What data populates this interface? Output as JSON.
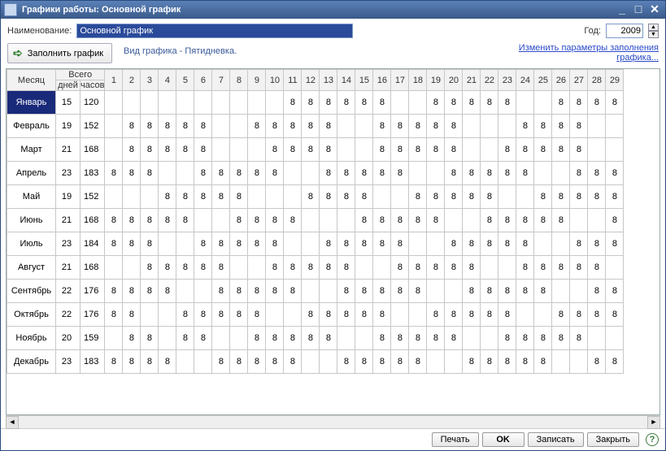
{
  "window": {
    "title": "Графики работы: Основной график"
  },
  "labels": {
    "name": "Наименование:",
    "year": "Год:",
    "info": "Вид графика - Пятидневка.",
    "fill": "Заполнить график",
    "change_link": "Изменить параметры заполнения графика...",
    "month": "Месяц",
    "total": "Всего",
    "days": "дней",
    "hours": "часов",
    "print": "Печать",
    "ok": "OK",
    "save": "Записать",
    "close": "Закрыть"
  },
  "fields": {
    "name_value": "Основной график",
    "year_value": "2009"
  },
  "days_header": [
    "1",
    "2",
    "3",
    "4",
    "5",
    "6",
    "7",
    "8",
    "9",
    "10",
    "11",
    "12",
    "13",
    "14",
    "15",
    "16",
    "17",
    "18",
    "19",
    "20",
    "21",
    "22",
    "23",
    "24",
    "25",
    "26",
    "27",
    "28",
    "29"
  ],
  "months": [
    {
      "name": "Январь",
      "days": "15",
      "hours": "120",
      "cells": [
        {
          "v": "",
          "w": true
        },
        {
          "v": "",
          "w": true
        },
        {
          "v": "",
          "w": true
        },
        {
          "v": "",
          "w": true
        },
        {
          "v": "",
          "w": true
        },
        {
          "v": "",
          "w": true
        },
        {
          "v": "",
          "w": true
        },
        {
          "v": "",
          "w": true
        },
        {
          "v": "",
          "w": true
        },
        {
          "v": "",
          "w": true
        },
        {
          "v": "8"
        },
        {
          "v": "8"
        },
        {
          "v": "8"
        },
        {
          "v": "8"
        },
        {
          "v": "8"
        },
        {
          "v": "8"
        },
        {
          "v": "",
          "w": true
        },
        {
          "v": "",
          "w": true
        },
        {
          "v": "8"
        },
        {
          "v": "8"
        },
        {
          "v": "8"
        },
        {
          "v": "8"
        },
        {
          "v": "8"
        },
        {
          "v": "",
          "w": true
        },
        {
          "v": "",
          "w": true
        },
        {
          "v": "8"
        },
        {
          "v": "8"
        },
        {
          "v": "8"
        },
        {
          "v": "8"
        }
      ]
    },
    {
      "name": "Февраль",
      "days": "19",
      "hours": "152",
      "cells": [
        {
          "v": "",
          "w": true
        },
        {
          "v": "8"
        },
        {
          "v": "8"
        },
        {
          "v": "8"
        },
        {
          "v": "8"
        },
        {
          "v": "8"
        },
        {
          "v": "",
          "w": true
        },
        {
          "v": "",
          "w": true
        },
        {
          "v": "8"
        },
        {
          "v": "8"
        },
        {
          "v": "8"
        },
        {
          "v": "8"
        },
        {
          "v": "8"
        },
        {
          "v": "",
          "w": true
        },
        {
          "v": "",
          "w": true
        },
        {
          "v": "8"
        },
        {
          "v": "8"
        },
        {
          "v": "8"
        },
        {
          "v": "8"
        },
        {
          "v": "8"
        },
        {
          "v": "",
          "w": true
        },
        {
          "v": "",
          "w": true
        },
        {
          "v": "",
          "w": true
        },
        {
          "v": "8"
        },
        {
          "v": "8"
        },
        {
          "v": "8"
        },
        {
          "v": "8"
        },
        {
          "v": "",
          "w": true
        },
        {
          "v": ""
        }
      ]
    },
    {
      "name": "Март",
      "days": "21",
      "hours": "168",
      "cells": [
        {
          "v": "",
          "w": true
        },
        {
          "v": "8"
        },
        {
          "v": "8"
        },
        {
          "v": "8"
        },
        {
          "v": "8"
        },
        {
          "v": "8"
        },
        {
          "v": "",
          "w": true
        },
        {
          "v": "",
          "w": true
        },
        {
          "v": "",
          "w": true
        },
        {
          "v": "8"
        },
        {
          "v": "8"
        },
        {
          "v": "8"
        },
        {
          "v": "8"
        },
        {
          "v": "",
          "w": true
        },
        {
          "v": "",
          "w": true
        },
        {
          "v": "8"
        },
        {
          "v": "8"
        },
        {
          "v": "8"
        },
        {
          "v": "8"
        },
        {
          "v": "8"
        },
        {
          "v": "",
          "w": true
        },
        {
          "v": "",
          "w": true
        },
        {
          "v": "8"
        },
        {
          "v": "8"
        },
        {
          "v": "8"
        },
        {
          "v": "8"
        },
        {
          "v": "8"
        },
        {
          "v": "",
          "w": true
        },
        {
          "v": "",
          "w": true
        }
      ]
    },
    {
      "name": "Апрель",
      "days": "23",
      "hours": "183",
      "cells": [
        {
          "v": "8"
        },
        {
          "v": "8"
        },
        {
          "v": "8"
        },
        {
          "v": "",
          "w": true
        },
        {
          "v": "",
          "w": true
        },
        {
          "v": "8"
        },
        {
          "v": "8"
        },
        {
          "v": "8"
        },
        {
          "v": "8"
        },
        {
          "v": "8"
        },
        {
          "v": "",
          "w": true
        },
        {
          "v": "",
          "w": true
        },
        {
          "v": "8"
        },
        {
          "v": "8"
        },
        {
          "v": "8"
        },
        {
          "v": "8"
        },
        {
          "v": "8"
        },
        {
          "v": "",
          "w": true
        },
        {
          "v": "",
          "w": true
        },
        {
          "v": "8"
        },
        {
          "v": "8"
        },
        {
          "v": "8"
        },
        {
          "v": "8"
        },
        {
          "v": "8"
        },
        {
          "v": "",
          "w": true
        },
        {
          "v": "",
          "w": true
        },
        {
          "v": "8"
        },
        {
          "v": "8"
        },
        {
          "v": "8"
        }
      ]
    },
    {
      "name": "Май",
      "days": "19",
      "hours": "152",
      "cells": [
        {
          "v": "",
          "w": true
        },
        {
          "v": "",
          "w": true
        },
        {
          "v": "",
          "w": true
        },
        {
          "v": "8"
        },
        {
          "v": "8"
        },
        {
          "v": "8"
        },
        {
          "v": "8"
        },
        {
          "v": "8"
        },
        {
          "v": "",
          "w": true
        },
        {
          "v": "",
          "w": true
        },
        {
          "v": "",
          "w": true
        },
        {
          "v": "8"
        },
        {
          "v": "8"
        },
        {
          "v": "8"
        },
        {
          "v": "8"
        },
        {
          "v": "",
          "w": true
        },
        {
          "v": "",
          "w": true
        },
        {
          "v": "8"
        },
        {
          "v": "8"
        },
        {
          "v": "8"
        },
        {
          "v": "8"
        },
        {
          "v": "8"
        },
        {
          "v": "",
          "w": true
        },
        {
          "v": "",
          "w": true
        },
        {
          "v": "8"
        },
        {
          "v": "8"
        },
        {
          "v": "8"
        },
        {
          "v": "8"
        },
        {
          "v": "8"
        }
      ]
    },
    {
      "name": "Июнь",
      "days": "21",
      "hours": "168",
      "cells": [
        {
          "v": "8"
        },
        {
          "v": "8"
        },
        {
          "v": "8"
        },
        {
          "v": "8"
        },
        {
          "v": "8"
        },
        {
          "v": "",
          "w": true
        },
        {
          "v": "",
          "w": true
        },
        {
          "v": "8"
        },
        {
          "v": "8"
        },
        {
          "v": "8"
        },
        {
          "v": "8"
        },
        {
          "v": "",
          "w": true
        },
        {
          "v": "",
          "w": true
        },
        {
          "v": "",
          "w": true
        },
        {
          "v": "8"
        },
        {
          "v": "8"
        },
        {
          "v": "8"
        },
        {
          "v": "8"
        },
        {
          "v": "8"
        },
        {
          "v": "",
          "w": true
        },
        {
          "v": "",
          "w": true
        },
        {
          "v": "8"
        },
        {
          "v": "8"
        },
        {
          "v": "8"
        },
        {
          "v": "8"
        },
        {
          "v": "8"
        },
        {
          "v": "",
          "w": true
        },
        {
          "v": "",
          "w": true
        },
        {
          "v": "8"
        }
      ]
    },
    {
      "name": "Июль",
      "days": "23",
      "hours": "184",
      "cells": [
        {
          "v": "8"
        },
        {
          "v": "8"
        },
        {
          "v": "8"
        },
        {
          "v": "",
          "w": true
        },
        {
          "v": "",
          "w": true
        },
        {
          "v": "8"
        },
        {
          "v": "8"
        },
        {
          "v": "8"
        },
        {
          "v": "8"
        },
        {
          "v": "8"
        },
        {
          "v": "",
          "w": true
        },
        {
          "v": "",
          "w": true
        },
        {
          "v": "8"
        },
        {
          "v": "8"
        },
        {
          "v": "8"
        },
        {
          "v": "8"
        },
        {
          "v": "8"
        },
        {
          "v": "",
          "w": true
        },
        {
          "v": "",
          "w": true
        },
        {
          "v": "8"
        },
        {
          "v": "8"
        },
        {
          "v": "8"
        },
        {
          "v": "8"
        },
        {
          "v": "8"
        },
        {
          "v": "",
          "w": true
        },
        {
          "v": "",
          "w": true
        },
        {
          "v": "8"
        },
        {
          "v": "8"
        },
        {
          "v": "8"
        }
      ]
    },
    {
      "name": "Август",
      "days": "21",
      "hours": "168",
      "cells": [
        {
          "v": "",
          "w": true
        },
        {
          "v": "",
          "w": true
        },
        {
          "v": "8"
        },
        {
          "v": "8"
        },
        {
          "v": "8"
        },
        {
          "v": "8"
        },
        {
          "v": "8"
        },
        {
          "v": "",
          "w": true
        },
        {
          "v": "",
          "w": true
        },
        {
          "v": "8"
        },
        {
          "v": "8"
        },
        {
          "v": "8"
        },
        {
          "v": "8"
        },
        {
          "v": "8"
        },
        {
          "v": "",
          "w": true
        },
        {
          "v": "",
          "w": true
        },
        {
          "v": "8"
        },
        {
          "v": "8"
        },
        {
          "v": "8"
        },
        {
          "v": "8"
        },
        {
          "v": "8"
        },
        {
          "v": "",
          "w": true
        },
        {
          "v": "",
          "w": true
        },
        {
          "v": "8"
        },
        {
          "v": "8"
        },
        {
          "v": "8"
        },
        {
          "v": "8"
        },
        {
          "v": "8"
        },
        {
          "v": "",
          "w": true
        }
      ]
    },
    {
      "name": "Сентябрь",
      "days": "22",
      "hours": "176",
      "cells": [
        {
          "v": "8"
        },
        {
          "v": "8"
        },
        {
          "v": "8"
        },
        {
          "v": "8"
        },
        {
          "v": "",
          "w": true
        },
        {
          "v": "",
          "w": true
        },
        {
          "v": "8"
        },
        {
          "v": "8"
        },
        {
          "v": "8"
        },
        {
          "v": "8"
        },
        {
          "v": "8"
        },
        {
          "v": "",
          "w": true
        },
        {
          "v": "",
          "w": true
        },
        {
          "v": "8"
        },
        {
          "v": "8"
        },
        {
          "v": "8"
        },
        {
          "v": "8"
        },
        {
          "v": "8"
        },
        {
          "v": "",
          "w": true
        },
        {
          "v": "",
          "w": true
        },
        {
          "v": "8"
        },
        {
          "v": "8"
        },
        {
          "v": "8"
        },
        {
          "v": "8"
        },
        {
          "v": "8"
        },
        {
          "v": "",
          "w": true
        },
        {
          "v": "",
          "w": true
        },
        {
          "v": "8"
        },
        {
          "v": "8"
        }
      ]
    },
    {
      "name": "Октябрь",
      "days": "22",
      "hours": "176",
      "cells": [
        {
          "v": "8"
        },
        {
          "v": "8"
        },
        {
          "v": "",
          "w": true
        },
        {
          "v": "",
          "w": true
        },
        {
          "v": "8"
        },
        {
          "v": "8"
        },
        {
          "v": "8"
        },
        {
          "v": "8"
        },
        {
          "v": "8"
        },
        {
          "v": "",
          "w": true
        },
        {
          "v": "",
          "w": true
        },
        {
          "v": "8"
        },
        {
          "v": "8"
        },
        {
          "v": "8"
        },
        {
          "v": "8"
        },
        {
          "v": "8"
        },
        {
          "v": "",
          "w": true
        },
        {
          "v": "",
          "w": true
        },
        {
          "v": "8"
        },
        {
          "v": "8"
        },
        {
          "v": "8"
        },
        {
          "v": "8"
        },
        {
          "v": "8"
        },
        {
          "v": "",
          "w": true
        },
        {
          "v": "",
          "w": true
        },
        {
          "v": "8"
        },
        {
          "v": "8"
        },
        {
          "v": "8"
        },
        {
          "v": "8"
        }
      ]
    },
    {
      "name": "Ноябрь",
      "days": "20",
      "hours": "159",
      "cells": [
        {
          "v": "",
          "w": true
        },
        {
          "v": "8"
        },
        {
          "v": "8"
        },
        {
          "v": "",
          "w": true
        },
        {
          "v": "8"
        },
        {
          "v": "8"
        },
        {
          "v": "",
          "w": true
        },
        {
          "v": "",
          "w": true
        },
        {
          "v": "8"
        },
        {
          "v": "8"
        },
        {
          "v": "8"
        },
        {
          "v": "8"
        },
        {
          "v": "8"
        },
        {
          "v": "",
          "w": true
        },
        {
          "v": "",
          "w": true
        },
        {
          "v": "8"
        },
        {
          "v": "8"
        },
        {
          "v": "8"
        },
        {
          "v": "8"
        },
        {
          "v": "8"
        },
        {
          "v": "",
          "w": true
        },
        {
          "v": "",
          "w": true
        },
        {
          "v": "8"
        },
        {
          "v": "8"
        },
        {
          "v": "8"
        },
        {
          "v": "8"
        },
        {
          "v": "8"
        },
        {
          "v": "",
          "w": true
        },
        {
          "v": "",
          "w": true
        }
      ]
    },
    {
      "name": "Декабрь",
      "days": "23",
      "hours": "183",
      "cells": [
        {
          "v": "8"
        },
        {
          "v": "8"
        },
        {
          "v": "8"
        },
        {
          "v": "8"
        },
        {
          "v": "",
          "w": true
        },
        {
          "v": "",
          "w": true
        },
        {
          "v": "8"
        },
        {
          "v": "8"
        },
        {
          "v": "8"
        },
        {
          "v": "8"
        },
        {
          "v": "8"
        },
        {
          "v": "",
          "w": true
        },
        {
          "v": "",
          "w": true
        },
        {
          "v": "8"
        },
        {
          "v": "8"
        },
        {
          "v": "8"
        },
        {
          "v": "8"
        },
        {
          "v": "8"
        },
        {
          "v": "",
          "w": true
        },
        {
          "v": "",
          "w": true
        },
        {
          "v": "8"
        },
        {
          "v": "8"
        },
        {
          "v": "8"
        },
        {
          "v": "8"
        },
        {
          "v": "8"
        },
        {
          "v": "",
          "w": true
        },
        {
          "v": "",
          "w": true
        },
        {
          "v": "8"
        },
        {
          "v": "8"
        }
      ]
    }
  ]
}
